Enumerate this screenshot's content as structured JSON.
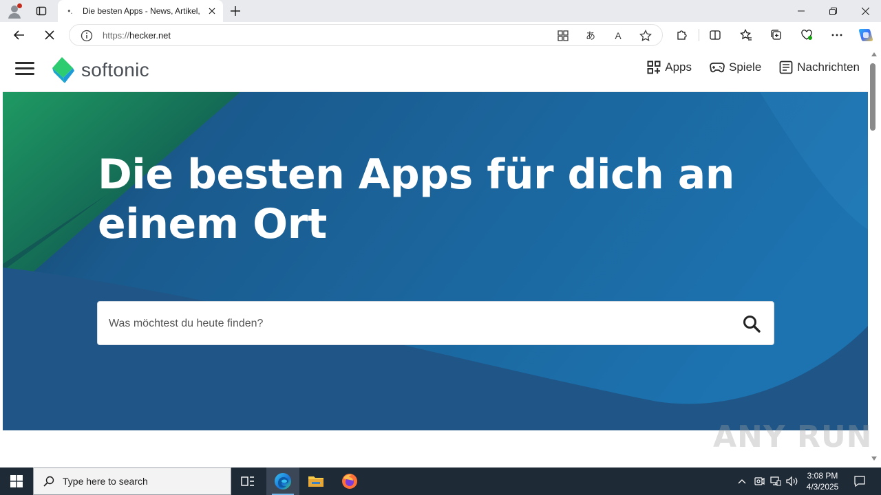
{
  "browser": {
    "tab_title": "Die besten Apps - News, Artikel, Vi",
    "url_protocol": "https://",
    "url_host": "hecker.net"
  },
  "site": {
    "logo_text": "softonic",
    "nav": [
      {
        "label": "Apps",
        "icon": "grid-icon"
      },
      {
        "label": "Spiele",
        "icon": "gamepad-icon"
      },
      {
        "label": "Nachrichten",
        "icon": "news-icon"
      }
    ],
    "hero_title": "Die besten Apps für dich an einem Ort",
    "search_placeholder": "Was möchtest du heute finden?"
  },
  "watermark": "ANY RUN",
  "taskbar": {
    "search_text": "Type here to search",
    "time": "3:08 PM",
    "date": "4/3/2025"
  },
  "colors": {
    "hero_blue": "#1c5f95",
    "hero_green": "#1f9a63",
    "logo_green": "#2ecc71",
    "logo_blue": "#1e9bd7",
    "taskbar": "#1f2a37"
  }
}
